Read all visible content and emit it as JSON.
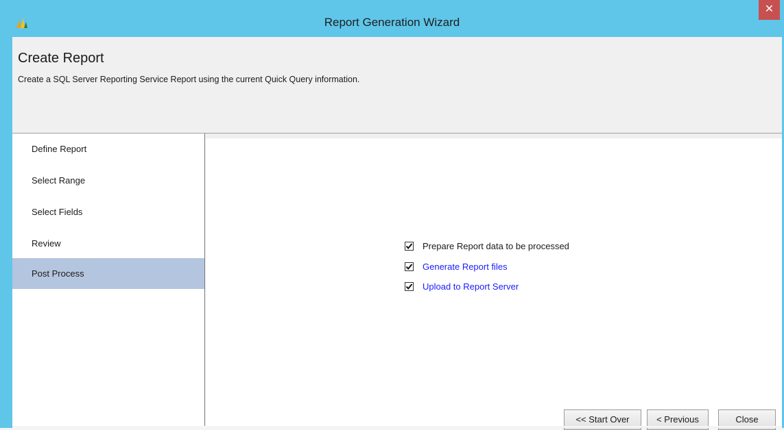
{
  "window": {
    "title": "Report Generation Wizard",
    "close_label": "✕",
    "app_icon": "chart-logo-icon"
  },
  "header": {
    "title": "Create Report",
    "subtitle": "Create a SQL Server Reporting Service Report using the current Quick Query information."
  },
  "nav": {
    "items": [
      {
        "label": "Define Report",
        "selected": false
      },
      {
        "label": "Select Range",
        "selected": false
      },
      {
        "label": "Select Fields",
        "selected": false
      },
      {
        "label": "Review",
        "selected": false
      },
      {
        "label": "Post Process",
        "selected": true
      }
    ]
  },
  "steps": [
    {
      "label": "Prepare Report data to be processed",
      "checked": true,
      "style": "normal"
    },
    {
      "label": "Generate Report files",
      "checked": true,
      "style": "link"
    },
    {
      "label": "Upload to Report Server",
      "checked": true,
      "style": "link"
    }
  ],
  "buttons": {
    "start_over": "<< Start Over",
    "previous": "< Previous",
    "close": "Close"
  },
  "colors": {
    "titlebar": "#5fc6ea",
    "close_button": "#c75050",
    "selected_nav": "#b4c5df",
    "link_text": "#1a1aff"
  }
}
